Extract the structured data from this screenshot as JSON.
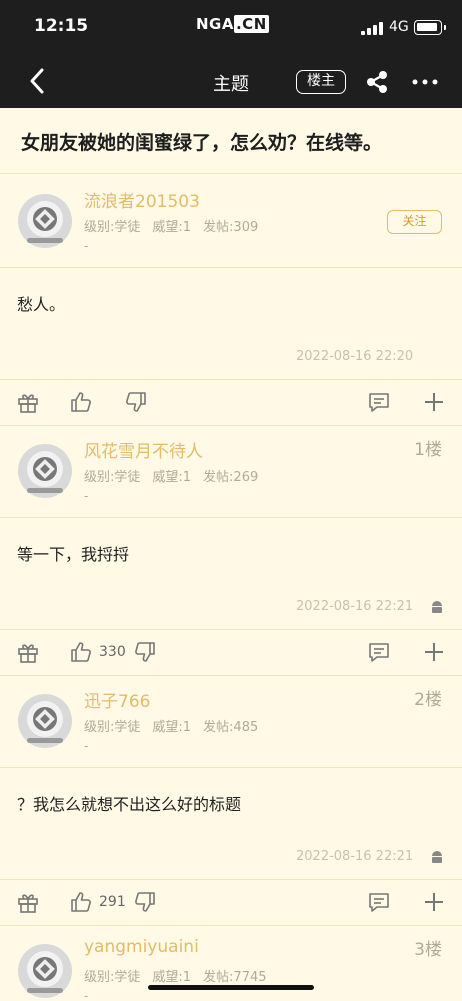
{
  "status_bar": {
    "time": "12:15",
    "network": "4G"
  },
  "app_logo": {
    "main": "NGA",
    "suffix": ".CN"
  },
  "nav": {
    "title": "主题",
    "louzhu_label": "楼主"
  },
  "thread": {
    "title": "女朋友被她的闺蜜绿了，怎么劝？在线等。"
  },
  "posts": [
    {
      "username": "流浪者201503",
      "level_label": "级别:学徒",
      "prestige_label": "威望:1",
      "post_count_label": "发帖:309",
      "extra": "-",
      "follow_label": "关注",
      "floor": "",
      "content": "愁人。",
      "time": "2022-08-16 22:20",
      "likes": ""
    },
    {
      "username": "风花雪月不待人",
      "level_label": "级别:学徒",
      "prestige_label": "威望:1",
      "post_count_label": "发帖:269",
      "extra": "-",
      "floor": "1楼",
      "content": "等一下，我捋捋",
      "time": "2022-08-16 22:21",
      "likes": "330"
    },
    {
      "username": "迅子766",
      "level_label": "级别:学徒",
      "prestige_label": "威望:1",
      "post_count_label": "发帖:485",
      "extra": "-",
      "floor": "2楼",
      "content": "？我怎么就想不出这么好的标题",
      "time": "2022-08-16 22:21",
      "likes": "291"
    },
    {
      "username": "yangmiyuaini",
      "level_label": "级别:学徒",
      "prestige_label": "威望:1",
      "post_count_label": "发帖:7745",
      "extra": "-",
      "floor": "3楼"
    }
  ],
  "icons": {
    "back": "chevron-left-icon",
    "share": "share-icon",
    "more": "more-icon",
    "gift": "gift-icon",
    "like": "thumbs-up-icon",
    "dislike": "thumbs-down-icon",
    "comment": "comment-icon",
    "plus": "plus-icon",
    "android": "android-icon"
  },
  "colors": {
    "topbar": "#1e1e1e",
    "background": "#fff9e6",
    "username": "#e0bc6b",
    "meta": "#b3aa96",
    "follow": "#d39d2c"
  }
}
